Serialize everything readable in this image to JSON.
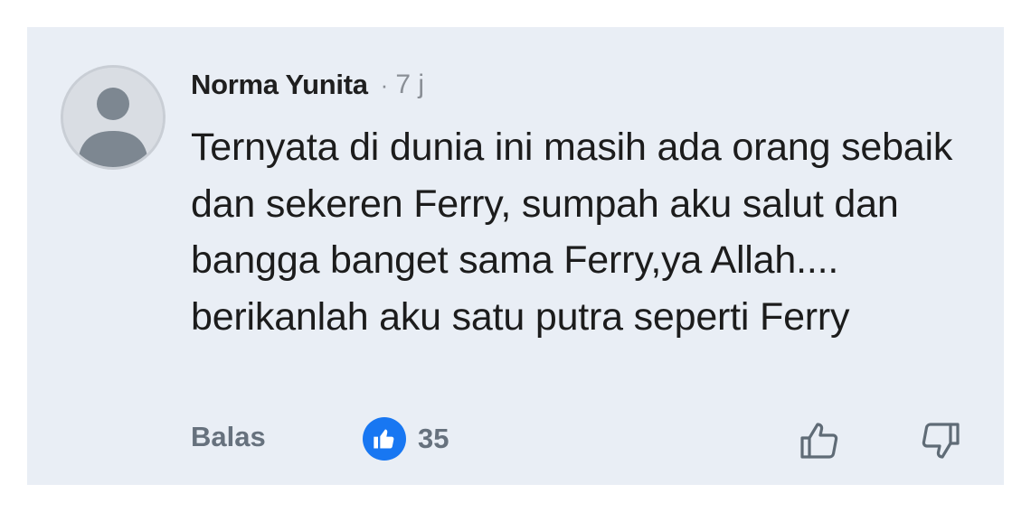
{
  "comment": {
    "author": "Norma Yunita",
    "separator": "·",
    "time": "7 j",
    "text": "Ternyata di dunia ini masih ada orang sebaik dan sekeren Ferry, sumpah aku salut dan bangga banget sama Ferry,ya Allah.... berikanlah aku satu putra seperti Ferry",
    "reply_label": "Balas",
    "like_count": "35"
  },
  "icons": {
    "avatar": "default-user-avatar",
    "reaction": "like-reaction-icon",
    "thumb_up": "thumb-up-icon",
    "thumb_down": "thumb-down-icon"
  },
  "colors": {
    "background": "#e9eef5",
    "like_blue": "#1877f2",
    "secondary_text": "#66717d"
  }
}
